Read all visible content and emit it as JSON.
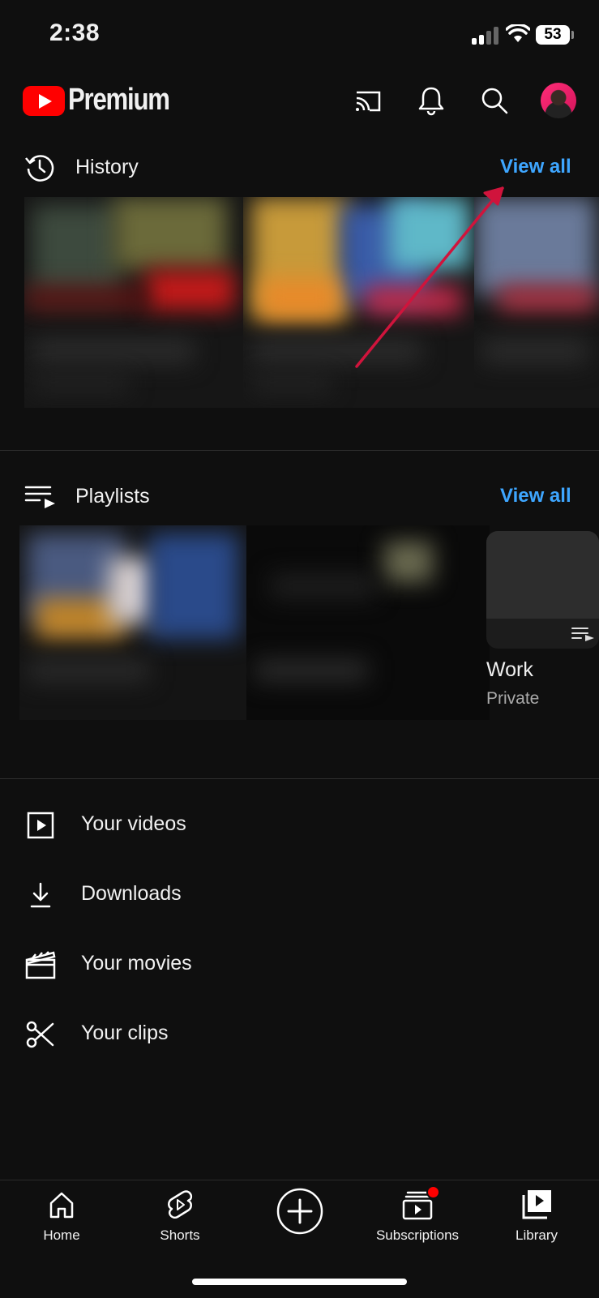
{
  "status_bar": {
    "time": "2:38",
    "battery": "53"
  },
  "header": {
    "brand": "Premium",
    "icons": [
      "cast-icon",
      "bell-icon",
      "search-icon",
      "avatar"
    ]
  },
  "history": {
    "title": "History",
    "view_all": "View all"
  },
  "playlists": {
    "title": "Playlists",
    "view_all": "View all",
    "items": [
      {
        "title": "Work",
        "subtitle": "Private"
      }
    ]
  },
  "menu": [
    {
      "label": "Your videos",
      "icon": "play-square-icon"
    },
    {
      "label": "Downloads",
      "icon": "download-icon"
    },
    {
      "label": "Your movies",
      "icon": "clapperboard-icon"
    },
    {
      "label": "Your clips",
      "icon": "scissors-icon"
    }
  ],
  "bottom_nav": [
    {
      "label": "Home",
      "icon": "home-icon"
    },
    {
      "label": "Shorts",
      "icon": "shorts-icon"
    },
    {
      "label": "",
      "icon": "create-icon"
    },
    {
      "label": "Subscriptions",
      "icon": "subscriptions-icon"
    },
    {
      "label": "Library",
      "icon": "library-icon"
    }
  ],
  "colors": {
    "background": "#0f0f0f",
    "accent_link": "#3ea6ff",
    "brand_red": "#ff0000",
    "annotation_arrow": "#d0143c"
  }
}
